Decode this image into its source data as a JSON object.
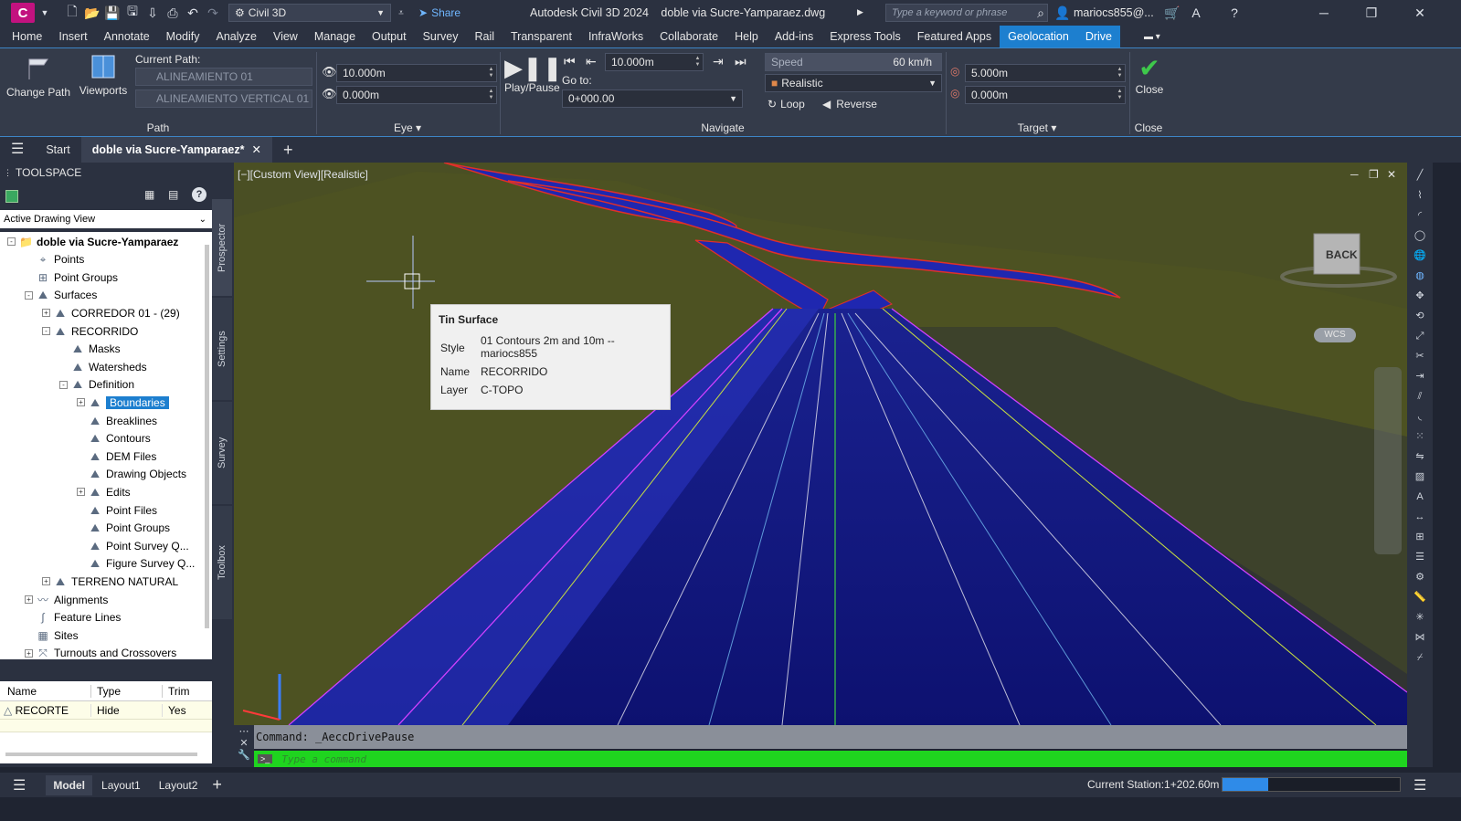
{
  "titlebar": {
    "app_letter": "C",
    "workspace": "Civil 3D",
    "share_label": "Share",
    "product": "Autodesk Civil 3D 2024",
    "filename": "doble via Sucre-Yamparaez.dwg",
    "search_placeholder": "Type a keyword or phrase",
    "user": "mariocs855@..."
  },
  "menu": [
    "Home",
    "Insert",
    "Annotate",
    "Modify",
    "Analyze",
    "View",
    "Manage",
    "Output",
    "Survey",
    "Rail",
    "Transparent",
    "InfraWorks",
    "Collaborate",
    "Help",
    "Add-ins",
    "Express Tools",
    "Featured Apps",
    "Geolocation",
    "Drive"
  ],
  "menu_active": [
    "Geolocation",
    "Drive"
  ],
  "ribbon": {
    "change_path": "Change Path",
    "viewports": "Viewports",
    "current_path_label": "Current Path:",
    "alignment": "ALINEAMIENTO 01",
    "profile": "ALINEAMIENTO VERTICAL 01",
    "path_panel": "Path",
    "eye_height": "10.000m",
    "eye_offset": "0.000m",
    "eye_panel": "Eye",
    "play_pause": "Play/Pause",
    "step_distance": "10.000m",
    "goto_label": "Go to:",
    "goto_value": "0+000.00",
    "speed_label": "Speed",
    "speed_value": "60 km/h",
    "visual_style": "Realistic",
    "loop": "Loop",
    "reverse": "Reverse",
    "navigate_panel": "Navigate",
    "target_distance": "5.000m",
    "target_offset": "0.000m",
    "target_panel": "Target",
    "close_label": "Close",
    "close_panel": "Close"
  },
  "doctabs": {
    "start": "Start",
    "drawing": "doble via Sucre-Yamparaez*"
  },
  "toolspace": {
    "title": "TOOLSPACE",
    "view_select": "Active Drawing View",
    "tree": [
      {
        "label": "doble via Sucre-Yamparaez",
        "level": 0,
        "exp": "-",
        "bold": true
      },
      {
        "label": "Points",
        "level": 1,
        "exp": ""
      },
      {
        "label": "Point Groups",
        "level": 1,
        "exp": ""
      },
      {
        "label": "Surfaces",
        "level": 1,
        "exp": "-"
      },
      {
        "label": "CORREDOR 01 - (29)",
        "level": 2,
        "exp": "+"
      },
      {
        "label": "RECORRIDO",
        "level": 2,
        "exp": "-"
      },
      {
        "label": "Masks",
        "level": 3,
        "exp": ""
      },
      {
        "label": "Watersheds",
        "level": 3,
        "exp": ""
      },
      {
        "label": "Definition",
        "level": 3,
        "exp": "-"
      },
      {
        "label": "Boundaries",
        "level": 4,
        "exp": "+",
        "selected": true
      },
      {
        "label": "Breaklines",
        "level": 4,
        "exp": ""
      },
      {
        "label": "Contours",
        "level": 4,
        "exp": ""
      },
      {
        "label": "DEM Files",
        "level": 4,
        "exp": ""
      },
      {
        "label": "Drawing Objects",
        "level": 4,
        "exp": ""
      },
      {
        "label": "Edits",
        "level": 4,
        "exp": "+"
      },
      {
        "label": "Point Files",
        "level": 4,
        "exp": ""
      },
      {
        "label": "Point Groups",
        "level": 4,
        "exp": ""
      },
      {
        "label": "Point Survey Q...",
        "level": 4,
        "exp": ""
      },
      {
        "label": "Figure Survey Q...",
        "level": 4,
        "exp": ""
      },
      {
        "label": "TERRENO NATURAL",
        "level": 2,
        "exp": "+"
      },
      {
        "label": "Alignments",
        "level": 1,
        "exp": "+"
      },
      {
        "label": "Feature Lines",
        "level": 1,
        "exp": ""
      },
      {
        "label": "Sites",
        "level": 1,
        "exp": ""
      },
      {
        "label": "Turnouts and Crossovers",
        "level": 1,
        "exp": "+"
      }
    ],
    "side_tabs": [
      "Prospector",
      "Settings",
      "Survey",
      "Toolbox"
    ],
    "table_headers": [
      "Name",
      "Type",
      "Trim"
    ],
    "table_row": [
      "RECORTE",
      "Hide",
      "Yes"
    ]
  },
  "viewport": {
    "label": "[−][Custom View][Realistic]",
    "viewcube": "BACK",
    "wcs": "WCS"
  },
  "tooltip": {
    "title": "Tin Surface",
    "rows": [
      {
        "k": "Style",
        "v": "01 Contours 2m and 10m -- mariocs855"
      },
      {
        "k": "Name",
        "v": "RECORRIDO"
      },
      {
        "k": "Layer",
        "v": "C-TOPO"
      }
    ]
  },
  "command": {
    "history": "Command:  _AeccDrivePause",
    "placeholder": "Type a command"
  },
  "statusbar": {
    "model": "Model",
    "layout1": "Layout1",
    "layout2": "Layout2",
    "station": "Current Station:1+202.60m",
    "progress": 0.26
  },
  "colors": {
    "accent": "#1d7fcf",
    "command_bar": "#1fd41f",
    "terrain": "#4d5222",
    "road": "#1a1a8a"
  }
}
